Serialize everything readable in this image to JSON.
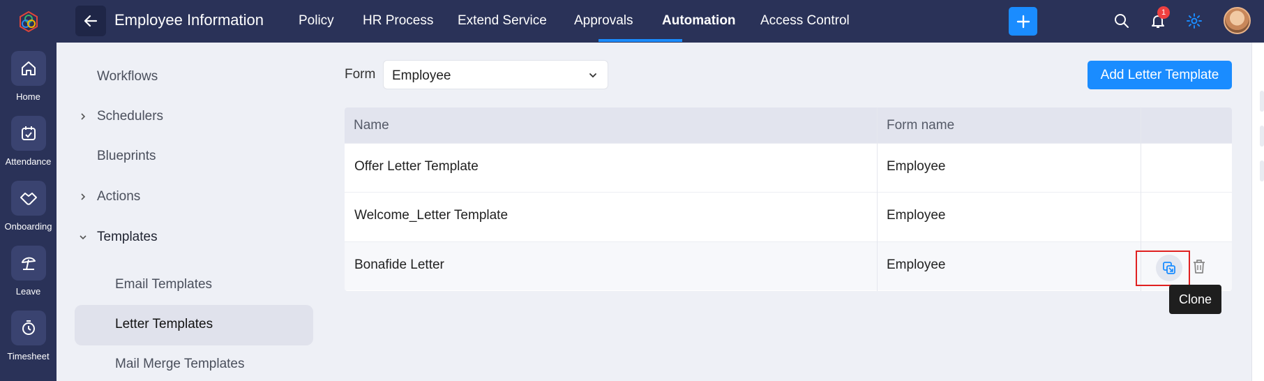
{
  "app": {
    "title": "Employee Information"
  },
  "rail": {
    "items": [
      {
        "label": "Home",
        "icon": "home-icon"
      },
      {
        "label": "Attendance",
        "icon": "calendar-check-icon"
      },
      {
        "label": "Onboarding",
        "icon": "handshake-icon"
      },
      {
        "label": "Leave",
        "icon": "beach-umbrella-icon"
      },
      {
        "label": "Timesheet",
        "icon": "timer-icon"
      }
    ]
  },
  "nav": {
    "tabs": [
      "Policy",
      "HR Process",
      "Extend Service",
      "Approvals",
      "Automation",
      "Access Control"
    ],
    "active": "Automation",
    "notification_count": "1"
  },
  "subnav": {
    "items": [
      "Workflows",
      "Schedulers",
      "Blueprints",
      "Actions",
      "Templates"
    ],
    "template_children": [
      "Email Templates",
      "Letter Templates",
      "Mail Merge Templates"
    ],
    "selected": "Letter Templates"
  },
  "filter": {
    "label": "Form",
    "value": "Employee"
  },
  "toolbar": {
    "add_label": "Add Letter Template"
  },
  "table": {
    "headers": [
      "Name",
      "Form name"
    ],
    "rows": [
      {
        "name": "Offer Letter Template",
        "form": "Employee"
      },
      {
        "name": "Welcome_Letter Template",
        "form": "Employee"
      },
      {
        "name": "Bonafide Letter",
        "form": "Employee"
      }
    ]
  },
  "tooltip": {
    "text": "Clone"
  },
  "colors": {
    "primary": "#1a8cff",
    "nav_bg": "#2a3258",
    "highlight": "#e02020"
  }
}
